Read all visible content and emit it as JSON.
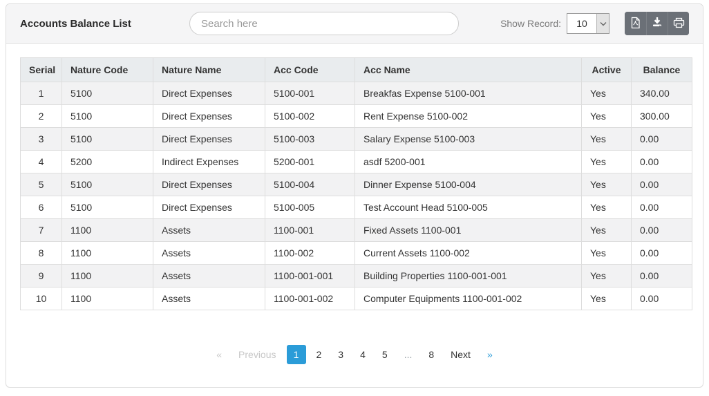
{
  "header": {
    "title": "Accounts Balance List",
    "search": {
      "placeholder": "Search here",
      "value": ""
    },
    "show_record": {
      "label": "Show Record:",
      "value": "10"
    },
    "toolbar": {
      "buttons": [
        {
          "name": "export-pdf-button",
          "icon": "file-pdf-icon"
        },
        {
          "name": "download-button",
          "icon": "download-icon"
        },
        {
          "name": "print-button",
          "icon": "print-icon"
        }
      ]
    }
  },
  "table": {
    "columns": [
      "Serial",
      "Nature Code",
      "Nature Name",
      "Acc Code",
      "Acc Name",
      "Active",
      "Balance"
    ],
    "column_keys": [
      "serial",
      "nature-code",
      "nature-name",
      "acc-code",
      "acc-name",
      "active",
      "balance"
    ],
    "rows": [
      [
        "1",
        "5100",
        "Direct Expenses",
        "5100-001",
        "Breakfas Expense 5100-001",
        "Yes",
        "340.00"
      ],
      [
        "2",
        "5100",
        "Direct Expenses",
        "5100-002",
        "Rent Expense 5100-002",
        "Yes",
        "300.00"
      ],
      [
        "3",
        "5100",
        "Direct Expenses",
        "5100-003",
        "Salary Expense 5100-003",
        "Yes",
        "0.00"
      ],
      [
        "4",
        "5200",
        "Indirect Expenses",
        "5200-001",
        "asdf 5200-001",
        "Yes",
        "0.00"
      ],
      [
        "5",
        "5100",
        "Direct Expenses",
        "5100-004",
        "Dinner Expense 5100-004",
        "Yes",
        "0.00"
      ],
      [
        "6",
        "5100",
        "Direct Expenses",
        "5100-005",
        "Test Account Head 5100-005",
        "Yes",
        "0.00"
      ],
      [
        "7",
        "1100",
        "Assets",
        "1100-001",
        "Fixed Assets 1100-001",
        "Yes",
        "0.00"
      ],
      [
        "8",
        "1100",
        "Assets",
        "1100-002",
        "Current Assets 1100-002",
        "Yes",
        "0.00"
      ],
      [
        "9",
        "1100",
        "Assets",
        "1100-001-001",
        "Building Properties 1100-001-001",
        "Yes",
        "0.00"
      ],
      [
        "10",
        "1100",
        "Assets",
        "1100-001-002",
        "Computer Equipments 1100-001-002",
        "Yes",
        "0.00"
      ]
    ]
  },
  "pagination": {
    "active_page": "1",
    "items": [
      {
        "label": "«",
        "name": "prev-arrow",
        "state": "disabled",
        "interactable": true
      },
      {
        "label": "Previous",
        "name": "prev-button",
        "state": "disabled",
        "interactable": true
      },
      {
        "label": "1",
        "name": "page-1",
        "state": "active",
        "interactable": true
      },
      {
        "label": "2",
        "name": "page-2",
        "state": "page",
        "interactable": true
      },
      {
        "label": "3",
        "name": "page-3",
        "state": "page",
        "interactable": true
      },
      {
        "label": "4",
        "name": "page-4",
        "state": "page",
        "interactable": true
      },
      {
        "label": "5",
        "name": "page-5",
        "state": "page",
        "interactable": true
      },
      {
        "label": "...",
        "name": "ellipsis",
        "state": "ellipsis",
        "interactable": false
      },
      {
        "label": "8",
        "name": "page-8",
        "state": "page",
        "interactable": true
      },
      {
        "label": "Next",
        "name": "next-button",
        "state": "page",
        "interactable": true
      },
      {
        "label": "»",
        "name": "next-arrow",
        "state": "arrow",
        "interactable": true
      }
    ]
  },
  "colors": {
    "active_page_bg": "#2b9cd8",
    "toolbar_bg": "#6b7077",
    "table_header_bg": "#e9ecee",
    "striped_row_bg": "#f2f2f3",
    "panel_header_bg": "#f5f5f6",
    "border": "#dddddd"
  }
}
